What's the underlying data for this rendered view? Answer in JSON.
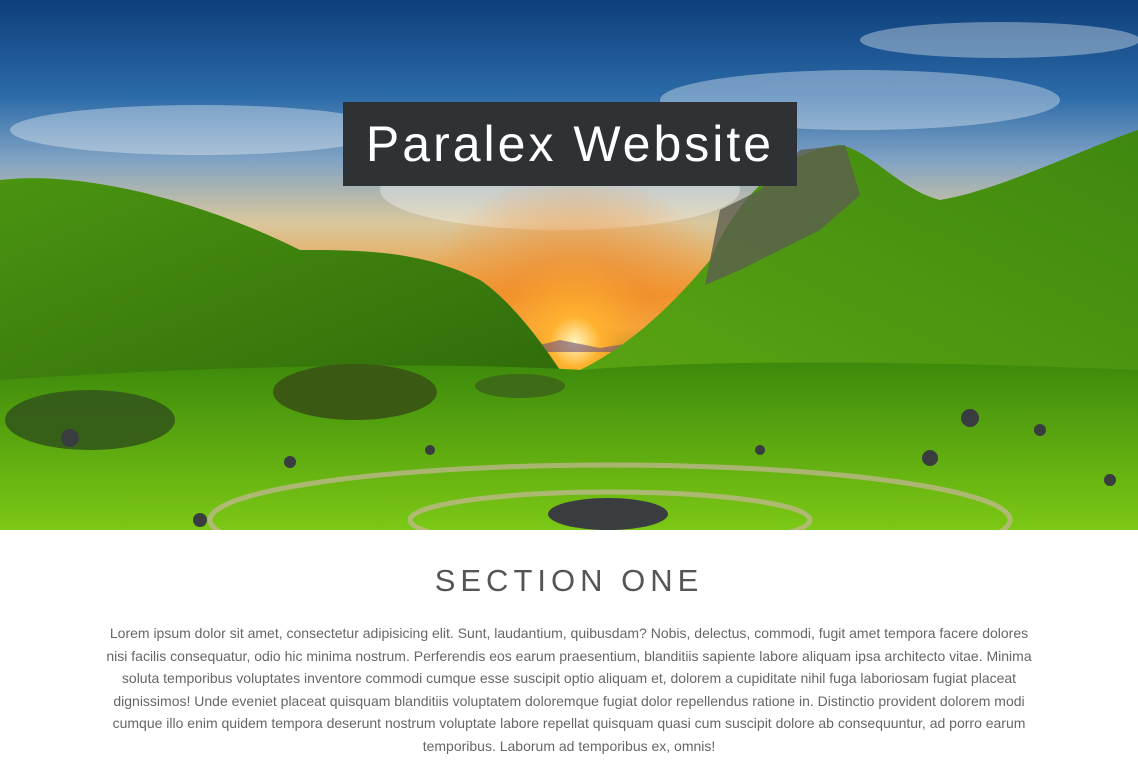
{
  "hero": {
    "title": "Paralex Website",
    "image": "landscape-hills-sunset-image"
  },
  "section_one": {
    "heading": "SECTION ONE",
    "body": "Lorem ipsum dolor sit amet, consectetur adipisicing elit. Sunt, laudantium, quibusdam? Nobis, delectus, commodi, fugit amet tempora facere dolores nisi facilis consequatur, odio hic minima nostrum. Perferendis eos earum praesentium, blanditiis sapiente labore aliquam ipsa architecto vitae. Minima soluta temporibus voluptates inventore commodi cumque esse suscipit optio aliquam et, dolorem a cupiditate nihil fuga laboriosam fugiat placeat dignissimos! Unde eveniet placeat quisquam blanditiis voluptatem doloremque fugiat dolor repellendus ratione in. Distinctio provident dolorem modi cumque illo enim quidem tempora deserunt nostrum voluptate labore repellat quisquam quasi cum suscipit dolore ab consequuntur, ad porro earum temporibus. Laborum ad temporibus ex, omnis!"
  },
  "colors": {
    "title_box_bg": "#2f3234",
    "heading_text": "#555555",
    "body_text": "#666666"
  }
}
